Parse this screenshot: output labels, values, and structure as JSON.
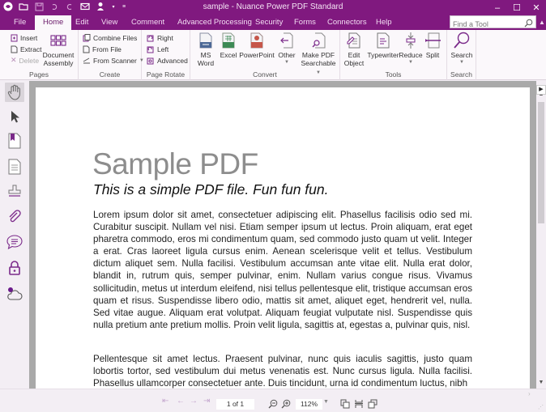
{
  "titlebar": {
    "title": "sample - Nuance Power PDF Standard",
    "quick_access": [
      "app-logo",
      "open",
      "save",
      "undo",
      "redo",
      "email",
      "user",
      "dropdown",
      "customize"
    ],
    "minimize": "–",
    "maximize": "☐",
    "close": "✕"
  },
  "tabs": [
    {
      "label": "File"
    },
    {
      "label": "Home",
      "active": true
    },
    {
      "label": "Edit"
    },
    {
      "label": "View"
    },
    {
      "label": "Comment"
    },
    {
      "label": "Advanced Processing"
    },
    {
      "label": "Security"
    },
    {
      "label": "Forms"
    },
    {
      "label": "Connectors"
    },
    {
      "label": "Help"
    }
  ],
  "find_tool": {
    "placeholder": "Find a Tool",
    "value": ""
  },
  "ribbon": {
    "pages": {
      "label": "Pages",
      "insert": "Insert",
      "extract": "Extract",
      "delete": "Delete",
      "document_assembly_1": "Document",
      "document_assembly_2": "Assembly"
    },
    "create": {
      "label": "Create",
      "combine_files": "Combine Files",
      "from_file": "From File",
      "from_scanner": "From Scanner"
    },
    "page_rotate": {
      "label": "Page Rotate",
      "right": "Right",
      "left": "Left",
      "advanced": "Advanced"
    },
    "convert": {
      "label": "Convert",
      "ms_word_1": "MS",
      "ms_word_2": "Word",
      "excel": "Excel",
      "powerpoint": "PowerPoint",
      "other": "Other",
      "make_searchable_1": "Make PDF",
      "make_searchable_2": "Searchable"
    },
    "tools": {
      "label": "Tools",
      "edit_object_1": "Edit",
      "edit_object_2": "Object",
      "typewriter": "Typewriter",
      "reduce": "Reduce",
      "split": "Split"
    },
    "search": {
      "label": "Search",
      "search": "Search"
    }
  },
  "rail": [
    "hand",
    "select",
    "bookmarks",
    "pages",
    "stamp",
    "attachments",
    "comments",
    "security",
    "cloud"
  ],
  "document": {
    "title": "Sample PDF",
    "subtitle": "This is a simple PDF file. Fun fun fun.",
    "paragraphs": [
      "Lorem ipsum dolor sit amet, consectetuer adipiscing elit. Phasellus facilisis odio sed mi. Curabitur suscipit. Nullam vel nisi. Etiam semper ipsum ut lectus. Proin aliquam, erat eget pharetra commodo, eros mi condimentum quam, sed commodo justo quam ut velit. Integer a erat. Cras laoreet ligula cursus enim. Aenean scelerisque velit et tellus. Vestibulum dictum aliquet sem. Nulla facilisi. Vestibulum accumsan ante vitae elit. Nulla erat dolor, blandit in, rutrum quis, semper pulvinar, enim. Nullam varius congue risus. Vivamus sollicitudin, metus ut interdum eleifend, nisi tellus pellentesque elit, tristique accumsan eros quam et risus. Suspendisse libero odio, mattis sit amet, aliquet eget, hendrerit vel, nulla. Sed vitae augue. Aliquam erat volutpat. Aliquam feugiat vulputate nisl. Suspendisse quis nulla pretium ante pretium mollis. Proin velit ligula, sagittis at, egestas a, pulvinar quis, nisl.",
      "Pellentesque sit amet lectus. Praesent pulvinar, nunc quis iaculis sagittis, justo quam lobortis tortor, sed vestibulum dui metus venenatis est. Nunc cursus ligula. Nulla facilisi. Phasellus ullamcorper consectetuer ante. Duis tincidunt, urna id condimentum luctus, nibh"
    ]
  },
  "navigation": {
    "page_indicator": "1 of 1",
    "zoom_level": "112%"
  },
  "colors": {
    "brand": "#80197f",
    "accent_icon": "#7b2a8a"
  }
}
